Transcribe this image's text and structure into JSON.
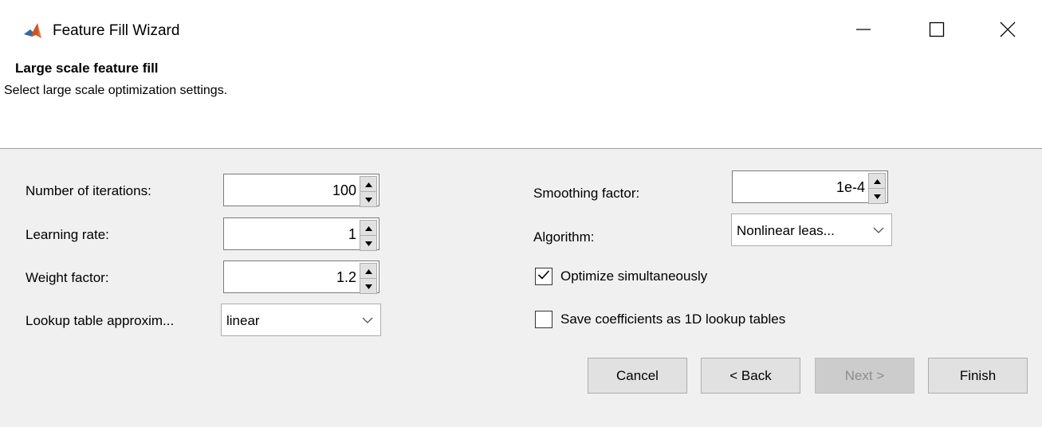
{
  "window": {
    "title": "Feature Fill Wizard",
    "icon": "matlab-icon",
    "controls": [
      "minimize-icon",
      "maximize-icon",
      "close-icon"
    ]
  },
  "header": {
    "title": "Large scale feature fill",
    "subtitle": "Select large scale optimization settings."
  },
  "left": {
    "iterations": {
      "label": "Number of iterations:",
      "value": "100"
    },
    "learning_rate": {
      "label": "Learning rate:",
      "value": "1"
    },
    "weight_factor": {
      "label": "Weight factor:",
      "value": "1.2"
    },
    "lookup_approx": {
      "label": "Lookup table approxim...",
      "value": "linear"
    }
  },
  "right": {
    "smoothing": {
      "label": "Smoothing factor:",
      "value": "1e-4"
    },
    "algorithm": {
      "label": "Algorithm:",
      "value": "Nonlinear leas..."
    },
    "optimize_simultaneously": {
      "label": "Optimize simultaneously",
      "checked": true
    },
    "save_coefficients": {
      "label": "Save coefficients as 1D lookup tables",
      "checked": false
    }
  },
  "buttons": {
    "cancel": "Cancel",
    "back": "< Back",
    "next": "Next >",
    "finish": "Finish"
  },
  "colors": {
    "panel_bg": "#f0f0f0",
    "button_bg": "#e1e1e1",
    "disabled_text": "#8d8d8d",
    "matlab_orange": "#c9542a",
    "matlab_blue": "#2b6cb0"
  }
}
